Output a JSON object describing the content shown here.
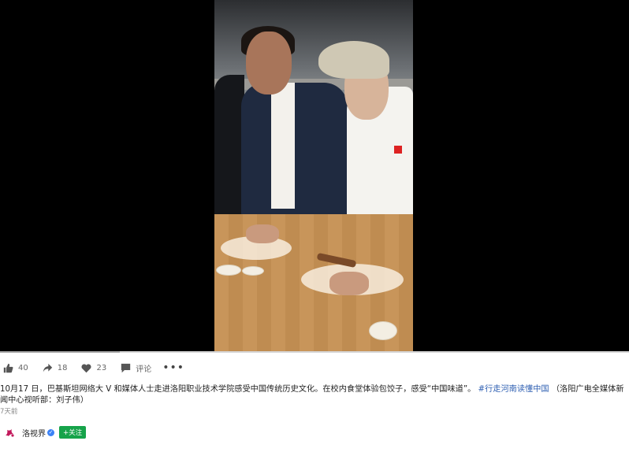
{
  "video": {
    "progress_fraction": 0.19
  },
  "actions": {
    "like_count": "40",
    "share_count": "18",
    "favorite_count": "23",
    "comment_label": "评论",
    "more_label": "•••",
    "icons": [
      "thumbs-up-icon",
      "share-icon",
      "heart-icon",
      "comment-icon"
    ]
  },
  "post": {
    "caption_text": "10月17 日，巴基斯坦网络大 V 和媒体人士走进洛阳职业技术学院感受中国传统历史文化。在校内食堂体验包饺子，感受“中国味道”。",
    "hashtag": "#行走河南读懂中国",
    "source_note": " （洛阳广电全媒体新闻中心视听部：刘子伟）",
    "time_ago": "7天前"
  },
  "author": {
    "name": "洛视界",
    "follow_label": "+关注",
    "brand_color": "#c2185b",
    "follow_color": "#16a34a"
  }
}
